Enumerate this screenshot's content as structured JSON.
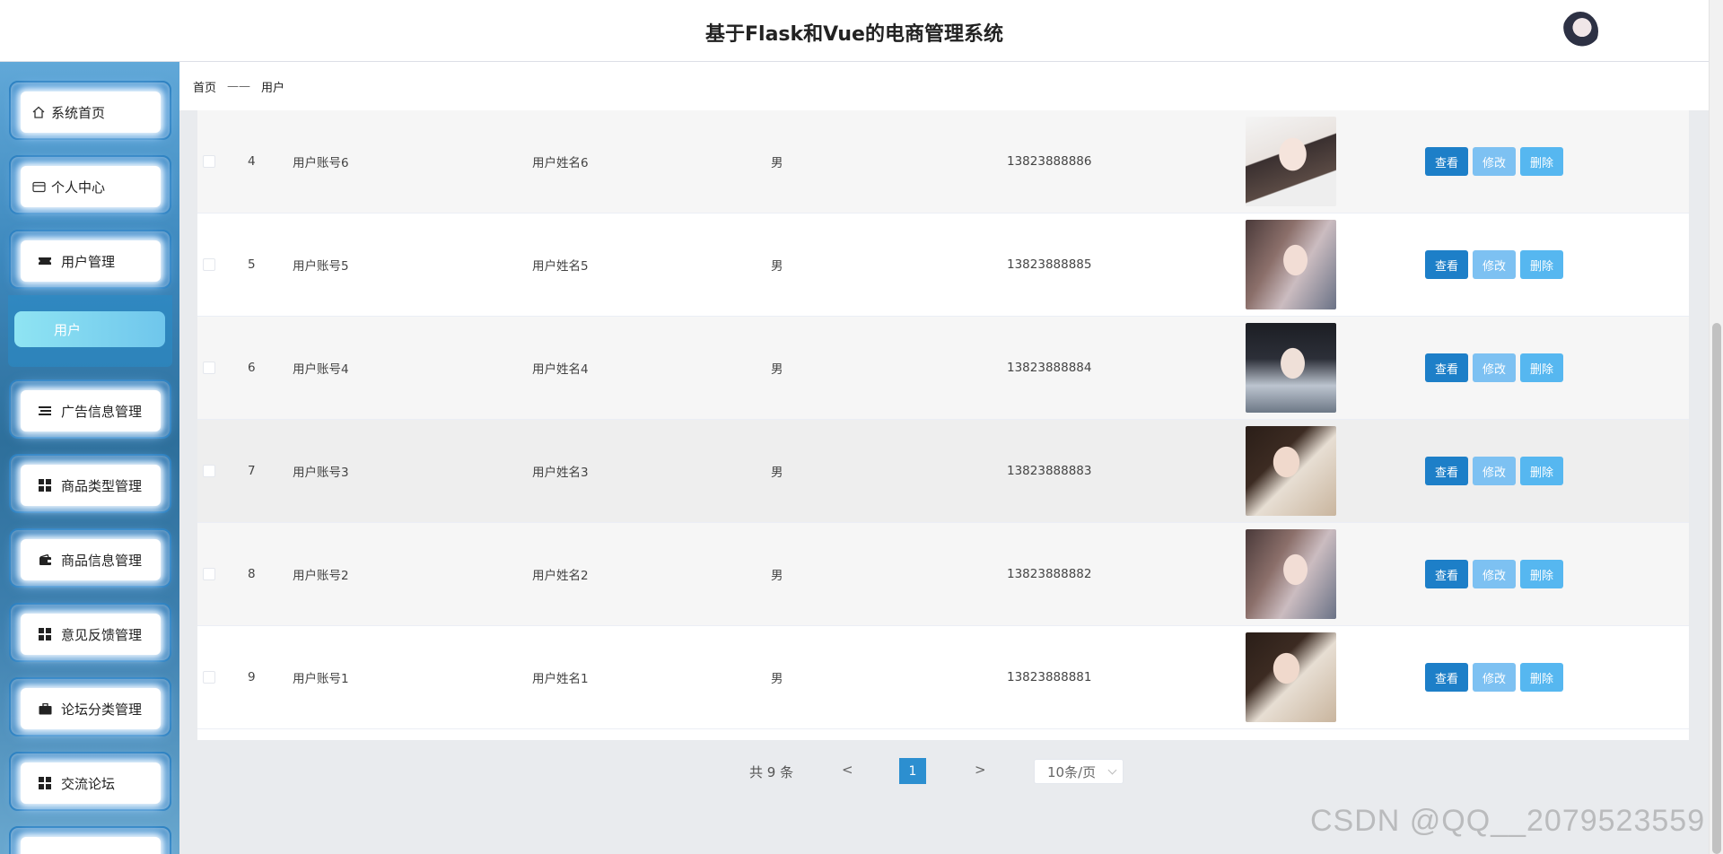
{
  "header": {
    "title": "基于Flask和Vue的电商管理系统"
  },
  "breadcrumb": {
    "home": "首页",
    "separator": "——",
    "current": "用户"
  },
  "sidebar": {
    "items": [
      {
        "label": "系统首页",
        "icon": "home-icon"
      },
      {
        "label": "个人中心",
        "icon": "id-card-icon"
      },
      {
        "label": "用户管理",
        "icon": "ticket-icon"
      },
      {
        "label": "广告信息管理",
        "icon": "list-icon"
      },
      {
        "label": "商品类型管理",
        "icon": "grid-icon"
      },
      {
        "label": "商品信息管理",
        "icon": "wallet-icon"
      },
      {
        "label": "意见反馈管理",
        "icon": "grid-icon"
      },
      {
        "label": "论坛分类管理",
        "icon": "briefcase-icon"
      },
      {
        "label": "交流论坛",
        "icon": "grid-icon"
      }
    ],
    "submenu": {
      "label": "用户"
    }
  },
  "table": {
    "rows": [
      {
        "index": "4",
        "account": "用户账号6",
        "name": "用户姓名6",
        "gender": "男",
        "phone": "13823888886"
      },
      {
        "index": "5",
        "account": "用户账号5",
        "name": "用户姓名5",
        "gender": "男",
        "phone": "13823888885"
      },
      {
        "index": "6",
        "account": "用户账号4",
        "name": "用户姓名4",
        "gender": "男",
        "phone": "13823888884"
      },
      {
        "index": "7",
        "account": "用户账号3",
        "name": "用户姓名3",
        "gender": "男",
        "phone": "13823888883"
      },
      {
        "index": "8",
        "account": "用户账号2",
        "name": "用户姓名2",
        "gender": "男",
        "phone": "13823888882"
      },
      {
        "index": "9",
        "account": "用户账号1",
        "name": "用户姓名1",
        "gender": "男",
        "phone": "13823888881"
      }
    ],
    "actions": {
      "view": "查看",
      "edit": "修改",
      "delete": "删除"
    }
  },
  "pagination": {
    "total": "共 9 条",
    "prev": "<",
    "current": "1",
    "next": ">",
    "page_size": "10条/页"
  },
  "watermark": "CSDN @QQ__2079523559",
  "colors": {
    "primary": "#1d7fc8",
    "edit": "#7dc1f2",
    "delete": "#56b7f0",
    "page_active": "#2c8fd0"
  }
}
